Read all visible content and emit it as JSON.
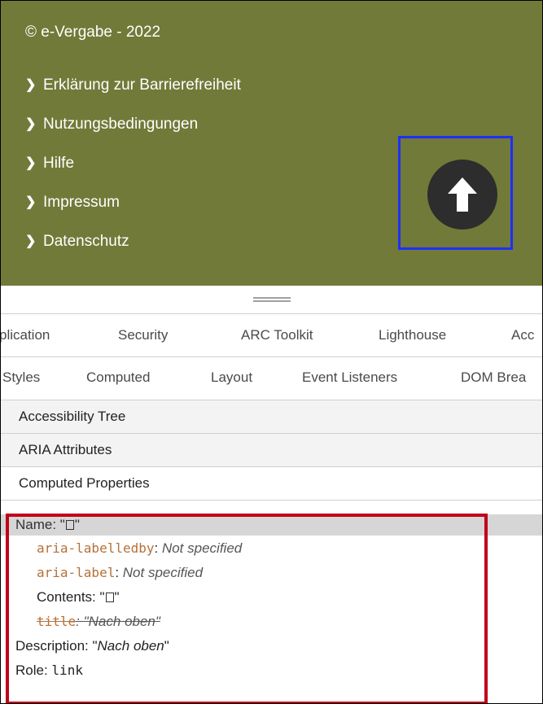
{
  "footer": {
    "copyright": "© e-Vergabe - 2022",
    "links": [
      {
        "label": "Erklärung zur Barrierefreiheit"
      },
      {
        "label": "Nutzungsbedingungen"
      },
      {
        "label": "Hilfe"
      },
      {
        "label": "Impressum"
      },
      {
        "label": "Datenschutz"
      }
    ],
    "back_to_top_icon": "arrow-up-circle-icon",
    "color": "#717a38"
  },
  "devtools": {
    "panel_tabs": [
      "plication",
      "Security",
      "ARC Toolkit",
      "Lighthouse",
      "Acc"
    ],
    "sidebar_tabs": [
      "Styles",
      "Computed",
      "Layout",
      "Event Listeners",
      "DOM Brea"
    ],
    "sections": [
      {
        "label": "Accessibility Tree"
      },
      {
        "label": "ARIA Attributes"
      },
      {
        "label": "Computed Properties"
      }
    ],
    "computed": {
      "name_label": "Name: ",
      "name_value_open": "\"",
      "name_value_close": "\"",
      "labelledby_key": "aria-labelledby",
      "labelledby_value": "Not specified",
      "label_key": "aria-label",
      "label_value": "Not specified",
      "contents_label": "Contents: ",
      "title_key": "title",
      "title_value": "\"Nach oben\"",
      "description_label": "Description: ",
      "description_value": "Nach oben",
      "role_label": "Role: ",
      "role_value": "link"
    }
  },
  "colors": {
    "highlight_blue": "#1f2fff",
    "highlight_red": "#c0001a"
  }
}
